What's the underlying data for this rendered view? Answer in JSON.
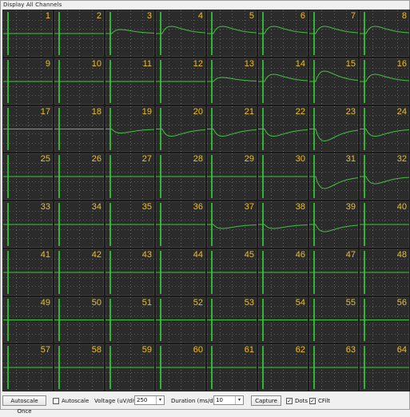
{
  "window": {
    "title": "Display All Channels"
  },
  "channels": [
    {
      "n": "1",
      "w": "flat"
    },
    {
      "n": "2",
      "w": "flat"
    },
    {
      "n": "3",
      "w": "bumpS"
    },
    {
      "n": "4",
      "w": "bump"
    },
    {
      "n": "5",
      "w": "bump"
    },
    {
      "n": "6",
      "w": "bump"
    },
    {
      "n": "7",
      "w": "bump"
    },
    {
      "n": "8",
      "w": "bump"
    },
    {
      "n": "9",
      "w": "flat"
    },
    {
      "n": "10",
      "w": "flat"
    },
    {
      "n": "11",
      "w": "flat"
    },
    {
      "n": "12",
      "w": "flat"
    },
    {
      "n": "13",
      "w": "bumpS"
    },
    {
      "n": "14",
      "w": "bump"
    },
    {
      "n": "15",
      "w": "bumpB"
    },
    {
      "n": "16",
      "w": "bump"
    },
    {
      "n": "17",
      "w": "flat"
    },
    {
      "n": "18",
      "w": "flat"
    },
    {
      "n": "19",
      "w": "dipS"
    },
    {
      "n": "20",
      "w": "dip"
    },
    {
      "n": "21",
      "w": "dip"
    },
    {
      "n": "22",
      "w": "dip"
    },
    {
      "n": "23",
      "w": "dipB"
    },
    {
      "n": "24",
      "w": "dip"
    },
    {
      "n": "25",
      "w": "flat"
    },
    {
      "n": "26",
      "w": "flat"
    },
    {
      "n": "27",
      "w": "flat"
    },
    {
      "n": "28",
      "w": "flat"
    },
    {
      "n": "29",
      "w": "flat"
    },
    {
      "n": "30",
      "w": "flat"
    },
    {
      "n": "31",
      "w": "dipB"
    },
    {
      "n": "32",
      "w": "dip"
    },
    {
      "n": "33",
      "w": "flat"
    },
    {
      "n": "34",
      "w": "flat"
    },
    {
      "n": "35",
      "w": "flat"
    },
    {
      "n": "36",
      "w": "flat"
    },
    {
      "n": "37",
      "w": "dipS"
    },
    {
      "n": "38",
      "w": "dipS"
    },
    {
      "n": "39",
      "w": "dip"
    },
    {
      "n": "40",
      "w": "flat"
    },
    {
      "n": "41",
      "w": "flat"
    },
    {
      "n": "42",
      "w": "flat"
    },
    {
      "n": "43",
      "w": "flat"
    },
    {
      "n": "44",
      "w": "flat"
    },
    {
      "n": "45",
      "w": "flat"
    },
    {
      "n": "46",
      "w": "flat"
    },
    {
      "n": "47",
      "w": "flat"
    },
    {
      "n": "48",
      "w": "flat"
    },
    {
      "n": "49",
      "w": "flat"
    },
    {
      "n": "50",
      "w": "flat"
    },
    {
      "n": "51",
      "w": "flat"
    },
    {
      "n": "52",
      "w": "flat"
    },
    {
      "n": "53",
      "w": "flat"
    },
    {
      "n": "54",
      "w": "flat"
    },
    {
      "n": "55",
      "w": "flat"
    },
    {
      "n": "56",
      "w": "flat"
    },
    {
      "n": "57",
      "w": "flat"
    },
    {
      "n": "58",
      "w": "flat"
    },
    {
      "n": "59",
      "w": "flat"
    },
    {
      "n": "60",
      "w": "flat"
    },
    {
      "n": "61",
      "w": "flat"
    },
    {
      "n": "62",
      "w": "flat"
    },
    {
      "n": "63",
      "w": "flat"
    },
    {
      "n": "64",
      "w": "flat"
    }
  ],
  "colors": {
    "trace": "#3ec63e",
    "stim": "#2fb52f",
    "grid_dots": "#8a8a8a",
    "channel_number": "#f0c020",
    "cell_bg": "#2b2b2b"
  },
  "toolbar": {
    "autoscale_once_label": "Autoscale Once",
    "autoscale_label": "Autoscale",
    "autoscale_checked": false,
    "voltage_label": "Voltage (uV/div)",
    "voltage_value": "250",
    "duration_label": "Duration (ms/div)",
    "duration_value": "10",
    "capture_label": "Capture",
    "dots_label": "Dots",
    "dots_checked": true,
    "cfilt_label": "CFilt",
    "cfilt_checked": true,
    "check_mark": "✓",
    "dropdown_arrow": "▾"
  }
}
